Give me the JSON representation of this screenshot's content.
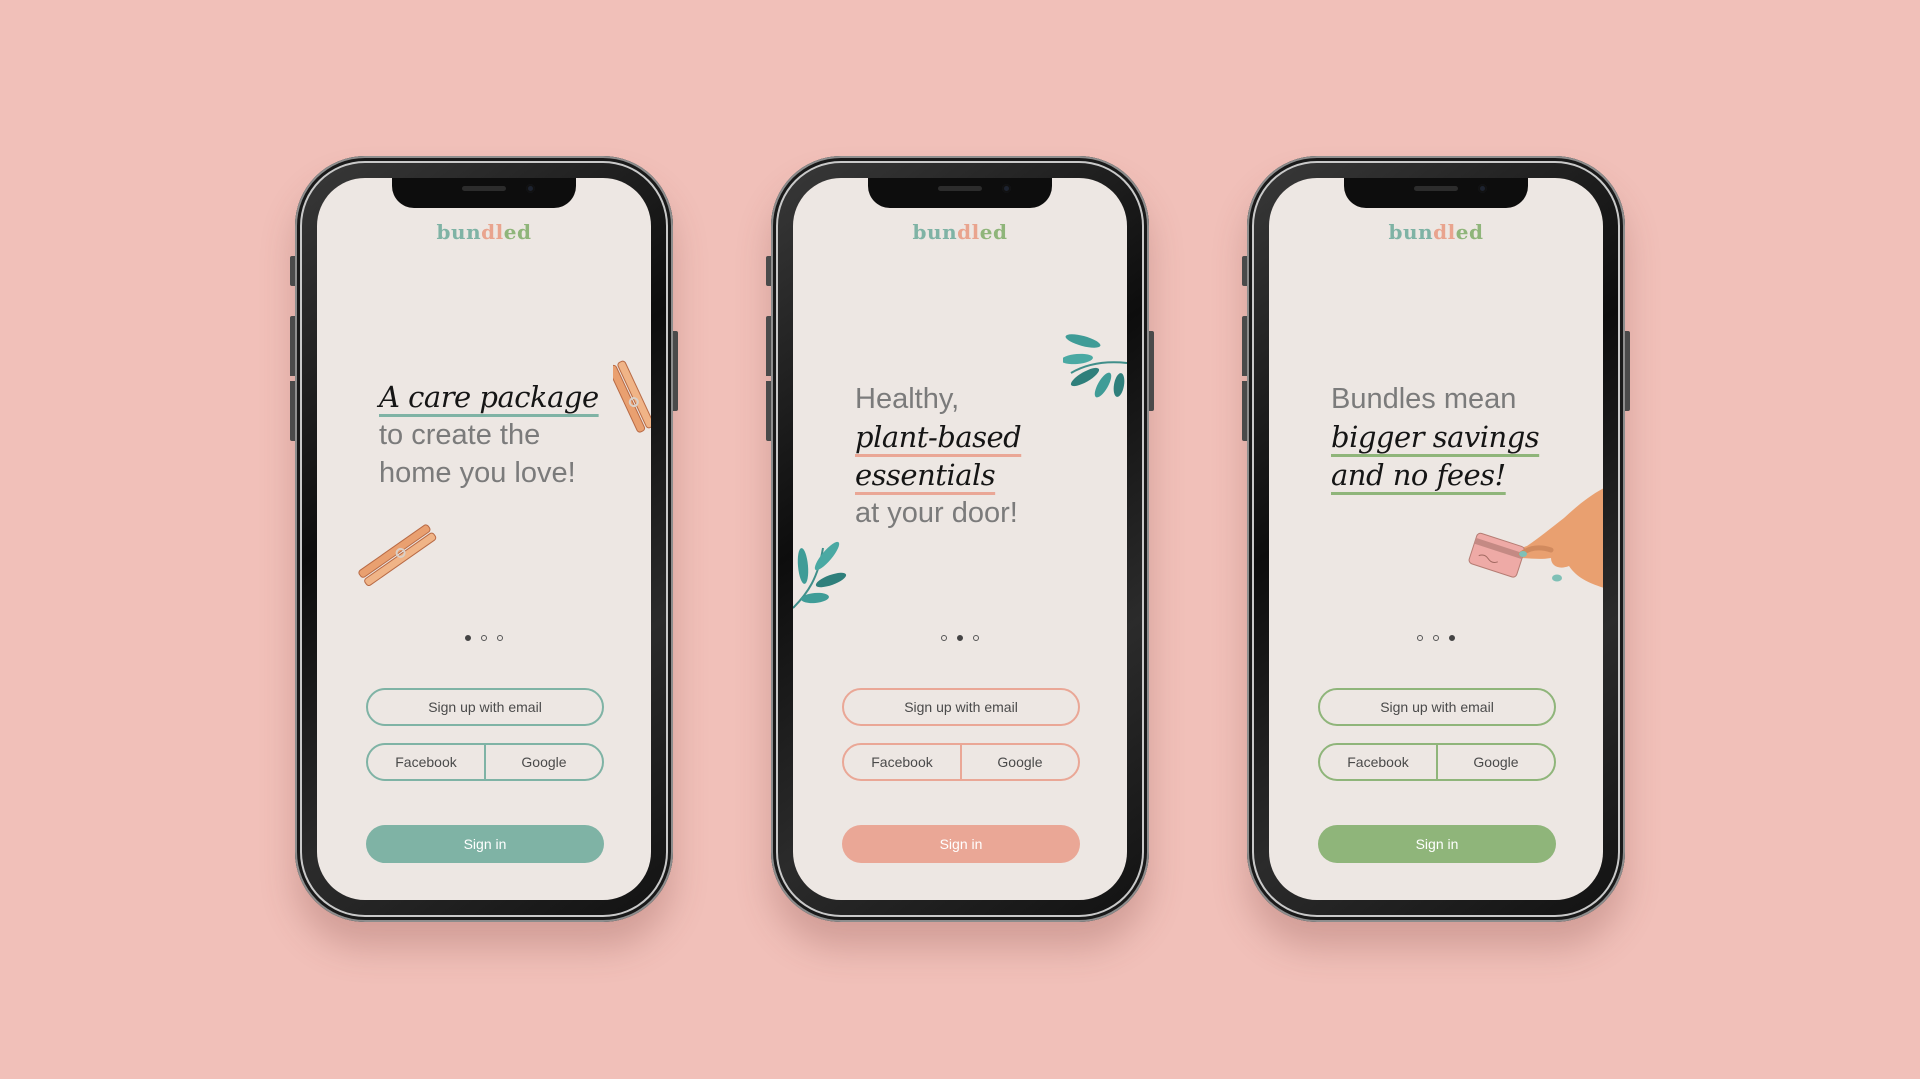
{
  "brand": {
    "logo_part1": "bun",
    "logo_part2": "dl",
    "logo_part3": "ed"
  },
  "screens": [
    {
      "accent": "#7fb3a5",
      "headline_em": [
        "A care package"
      ],
      "headline_plain": [
        "to create the",
        "home you love!"
      ],
      "active_dot": 0,
      "sign_up_email": "Sign up with email",
      "facebook": "Facebook",
      "google": "Google",
      "sign_in": "Sign in"
    },
    {
      "accent": "#eaa796",
      "headline_lead": "Healthy,",
      "headline_em": [
        "plant-based",
        "essentials"
      ],
      "headline_plain": [
        "at your door!"
      ],
      "active_dot": 1,
      "sign_up_email": "Sign up with email",
      "facebook": "Facebook",
      "google": "Google",
      "sign_in": "Sign in"
    },
    {
      "accent": "#8fb57a",
      "headline_lead": "Bundles mean",
      "headline_em": [
        "bigger savings",
        "and no fees!"
      ],
      "active_dot": 2,
      "sign_up_email": "Sign up with email",
      "facebook": "Facebook",
      "google": "Google",
      "sign_in": "Sign in"
    }
  ],
  "colors": {
    "background": "#f1c0b9",
    "screen": "#ede7e3"
  },
  "icons": {
    "screen1": "clothespin-icon",
    "screen2": "leaf-icon",
    "screen3": "hand-holding-card-icon"
  }
}
